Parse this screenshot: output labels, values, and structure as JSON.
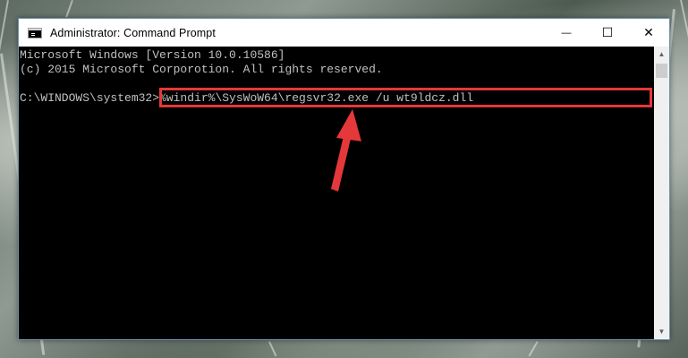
{
  "window": {
    "title": "Administrator: Command Prompt",
    "controls": {
      "minimize": "—",
      "maximize": "☐",
      "close": "✕"
    }
  },
  "console": {
    "lines": [
      "Microsoft Windows [Version 10.0.10586]",
      "(c) 2015 Microsoft Corporotion. All rights reserved."
    ],
    "prompt": "C:\\WINDOWS\\system32>",
    "command": "%windir%\\SysWoW64\\regsvr32.exe /u wt9ldcz.dll"
  },
  "annotation": {
    "color": "#e5383b"
  },
  "scrollbar": {
    "up_icon": "triangle-up-icon",
    "down_icon": "triangle-down-icon"
  }
}
